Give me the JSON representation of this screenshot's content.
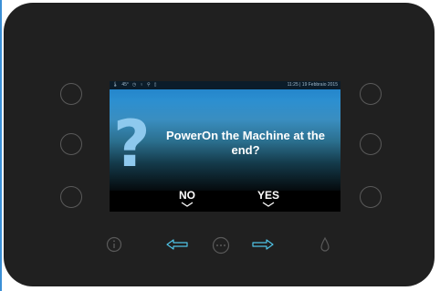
{
  "status_bar": {
    "temperature": "45°",
    "datetime": "11:25 | 19 Febbraio 2015"
  },
  "dialog": {
    "message": "PowerOn the Machine at the end?",
    "no_label": "NO",
    "yes_label": "YES"
  },
  "icons": {
    "dialog": "question-mark-icon",
    "bottom": [
      "info-icon",
      "left-arrow-icon",
      "menu-dots-icon",
      "right-arrow-icon",
      "water-drop-icon"
    ]
  },
  "colors": {
    "panel": "#202020",
    "accent": "#4fc3e6",
    "dim_icon": "#5a5a5a"
  }
}
